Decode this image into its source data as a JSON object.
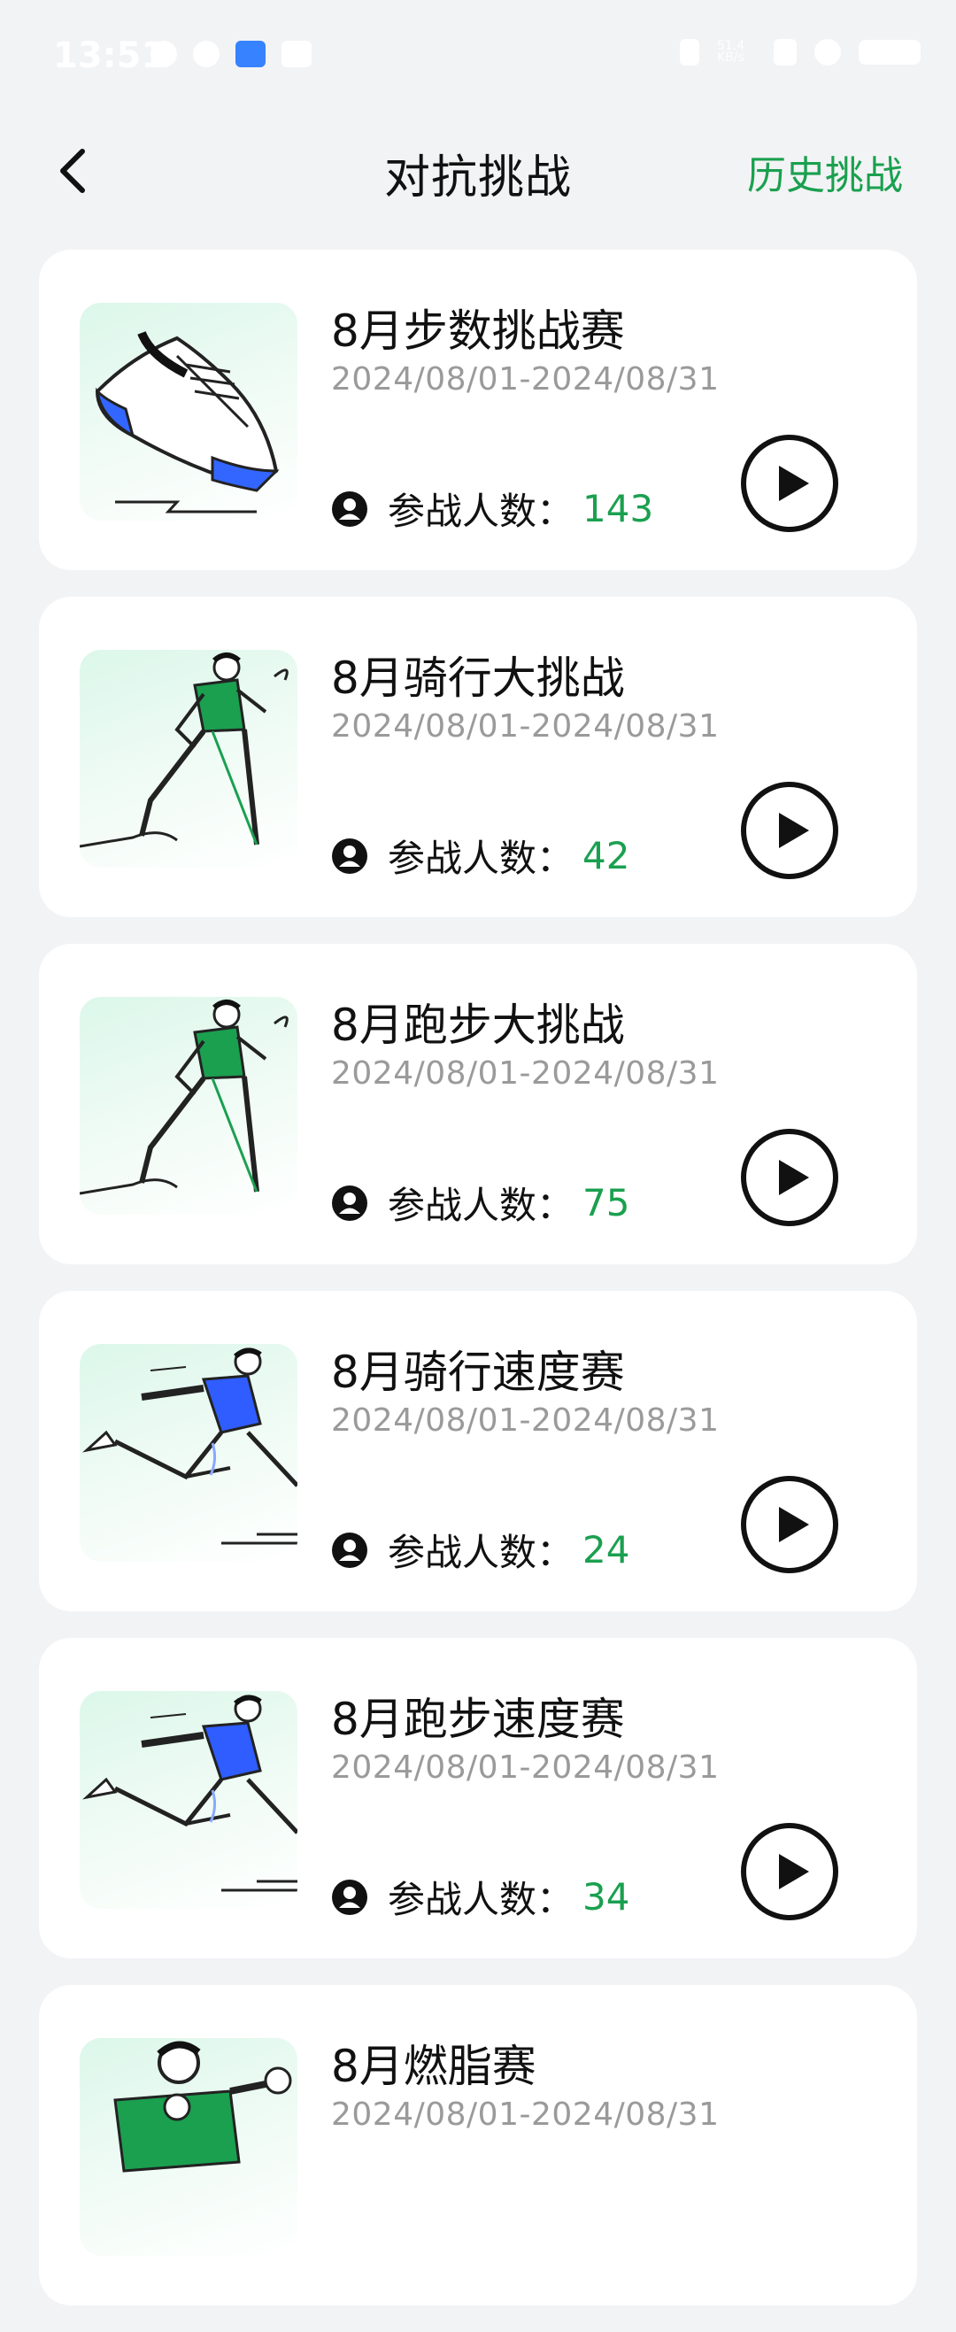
{
  "status_bar": {
    "time": "13:51",
    "net_speed": "51.4 KB/s"
  },
  "header": {
    "title": "对抗挑战",
    "history_label": "历史挑战"
  },
  "participants_label": "参战人数：",
  "challenges": [
    {
      "title": "8月步数挑战赛",
      "date": "2024/08/01-2024/08/31",
      "count": "143",
      "illustration": "sneaker-illustration"
    },
    {
      "title": "8月骑行大挑战",
      "date": "2024/08/01-2024/08/31",
      "count": "42",
      "illustration": "walker-illustration"
    },
    {
      "title": "8月跑步大挑战",
      "date": "2024/08/01-2024/08/31",
      "count": "75",
      "illustration": "walker-illustration"
    },
    {
      "title": "8月骑行速度赛",
      "date": "2024/08/01-2024/08/31",
      "count": "24",
      "illustration": "runner-illustration"
    },
    {
      "title": "8月跑步速度赛",
      "date": "2024/08/01-2024/08/31",
      "count": "34",
      "illustration": "runner-illustration"
    },
    {
      "title": "8月燃脂赛",
      "date": "2024/08/01-2024/08/31",
      "count": "",
      "illustration": "boxer-illustration"
    }
  ],
  "colors": {
    "accent": "#1aa04f",
    "background": "#f2f3f5",
    "card": "#ffffff",
    "date_text": "#9a9a9a"
  }
}
